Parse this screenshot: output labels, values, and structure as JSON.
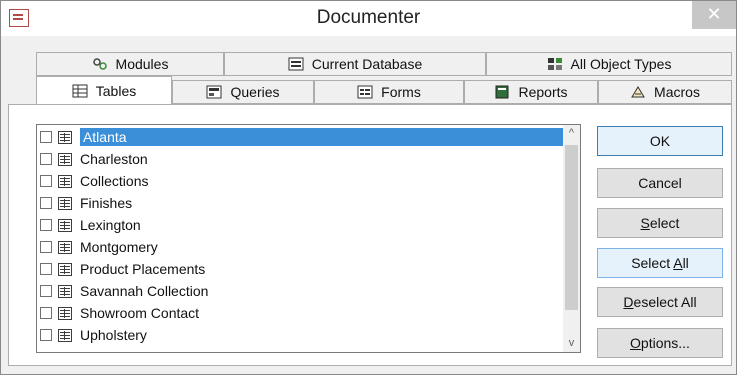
{
  "window": {
    "title": "Documenter",
    "close_glyph": "✕"
  },
  "tabs_row1": [
    {
      "label": "Modules",
      "icon": "modules-icon"
    },
    {
      "label": "Current Database",
      "icon": "current-database-icon"
    },
    {
      "label": "All Object Types",
      "icon": "all-object-types-icon"
    }
  ],
  "tabs_row2": [
    {
      "label": "Tables",
      "icon": "table-icon",
      "active": true
    },
    {
      "label": "Queries",
      "icon": "query-icon"
    },
    {
      "label": "Forms",
      "icon": "form-icon"
    },
    {
      "label": "Reports",
      "icon": "report-icon"
    },
    {
      "label": "Macros",
      "icon": "macro-icon"
    }
  ],
  "items": [
    {
      "label": "Atlanta",
      "checked": false,
      "selected": true
    },
    {
      "label": "Charleston",
      "checked": false
    },
    {
      "label": "Collections",
      "checked": false
    },
    {
      "label": "Finishes",
      "checked": false
    },
    {
      "label": "Lexington",
      "checked": false
    },
    {
      "label": "Montgomery",
      "checked": false
    },
    {
      "label": "Product Placements",
      "checked": false
    },
    {
      "label": "Savannah Collection",
      "checked": false
    },
    {
      "label": "Showroom Contact",
      "checked": false
    },
    {
      "label": "Upholstery",
      "checked": false
    }
  ],
  "buttons": {
    "ok": "OK",
    "cancel": "Cancel",
    "select_pre": "",
    "select_u": "S",
    "select_post": "elect",
    "select_all_pre": "Select ",
    "select_all_u": "A",
    "select_all_post": "ll",
    "deselect_all_pre": "",
    "deselect_all_u": "D",
    "deselect_all_post": "eselect All",
    "options_pre": "",
    "options_u": "O",
    "options_post": "ptions..."
  },
  "scroll": {
    "up_glyph": "^",
    "down_glyph": "v"
  },
  "colors": {
    "selection": "#3b8fd9",
    "default_button_border": "#3c7fb1"
  }
}
